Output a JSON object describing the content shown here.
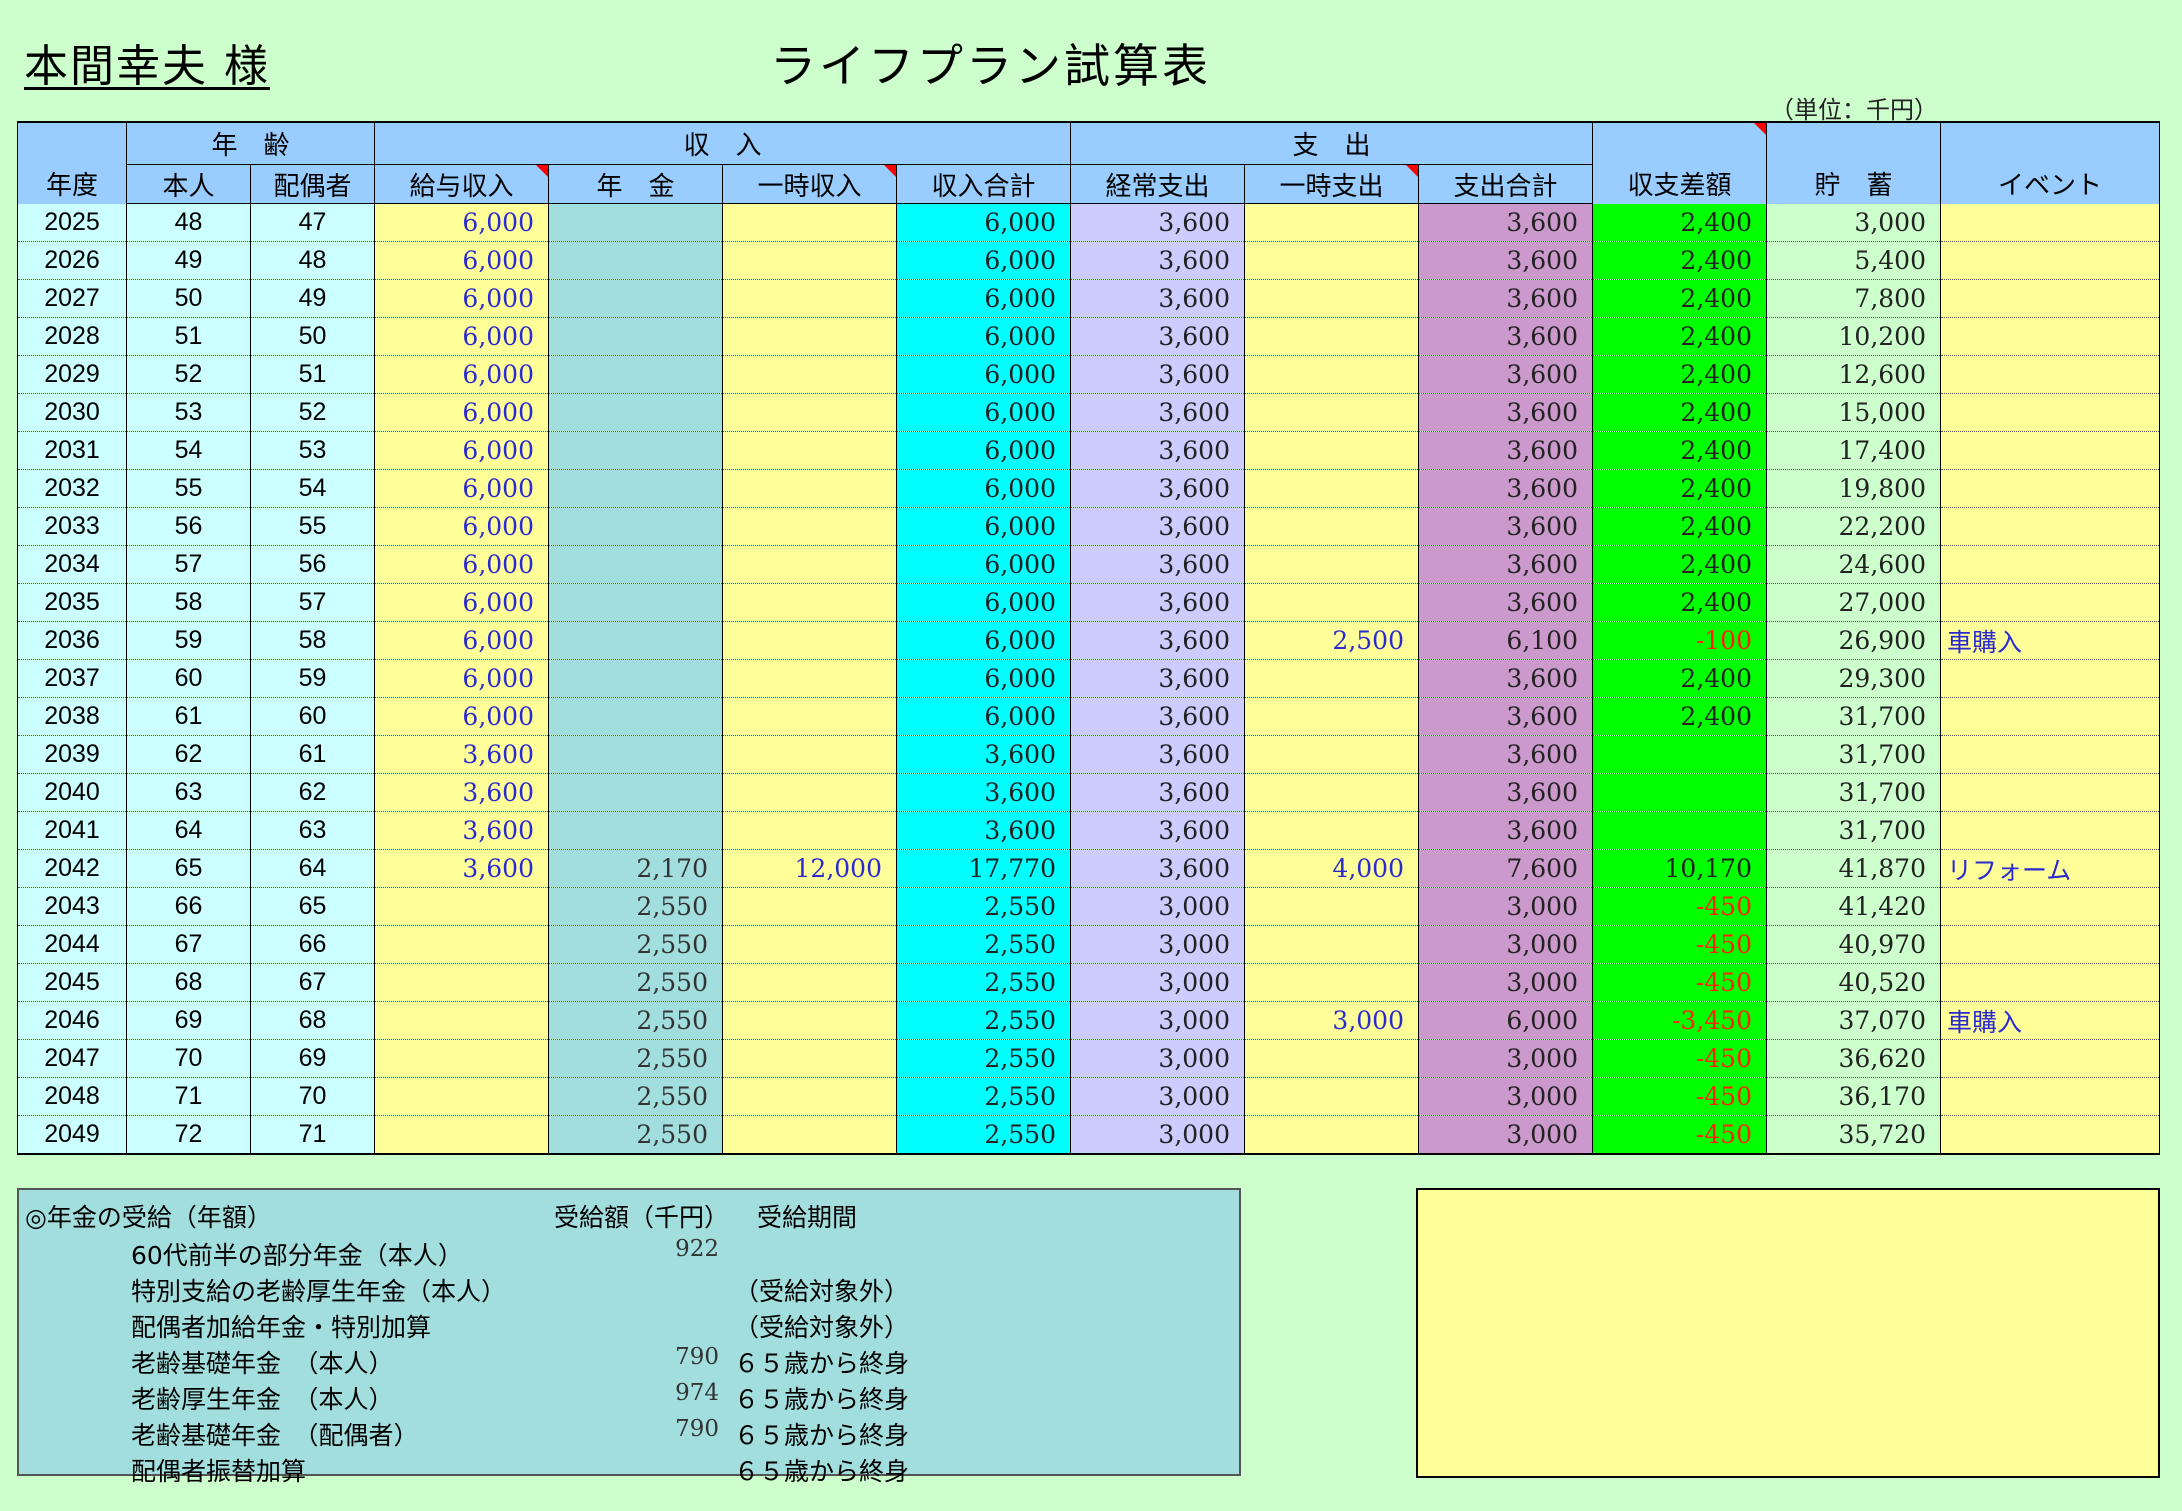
{
  "owner": "本間幸夫 様",
  "title": "ライフプラン試算表",
  "unit_note": "（単位：千円）",
  "headers": {
    "year": "年度",
    "age_group": "年　齢",
    "self": "本人",
    "spouse": "配偶者",
    "income_group": "収　入",
    "salary": "給与収入",
    "pension": "年　金",
    "temp_income": "一時収入",
    "income_total": "収入合計",
    "expense_group": "支　出",
    "regular_exp": "経常支出",
    "temp_exp": "一時支出",
    "exp_total": "支出合計",
    "balance": "収支差額",
    "savings": "貯　蓄",
    "event": "イベント"
  },
  "rows": [
    {
      "year": "2025",
      "self": "48",
      "spouse": "47",
      "salary": "6,000",
      "pension": "",
      "temp_in": "",
      "in_total": "6,000",
      "regular": "3,600",
      "temp_out": "",
      "out_total": "3,600",
      "balance": "2,400",
      "neg": false,
      "savings": "3,000",
      "event": ""
    },
    {
      "year": "2026",
      "self": "49",
      "spouse": "48",
      "salary": "6,000",
      "pension": "",
      "temp_in": "",
      "in_total": "6,000",
      "regular": "3,600",
      "temp_out": "",
      "out_total": "3,600",
      "balance": "2,400",
      "neg": false,
      "savings": "5,400",
      "event": ""
    },
    {
      "year": "2027",
      "self": "50",
      "spouse": "49",
      "salary": "6,000",
      "pension": "",
      "temp_in": "",
      "in_total": "6,000",
      "regular": "3,600",
      "temp_out": "",
      "out_total": "3,600",
      "balance": "2,400",
      "neg": false,
      "savings": "7,800",
      "event": ""
    },
    {
      "year": "2028",
      "self": "51",
      "spouse": "50",
      "salary": "6,000",
      "pension": "",
      "temp_in": "",
      "in_total": "6,000",
      "regular": "3,600",
      "temp_out": "",
      "out_total": "3,600",
      "balance": "2,400",
      "neg": false,
      "savings": "10,200",
      "event": ""
    },
    {
      "year": "2029",
      "self": "52",
      "spouse": "51",
      "salary": "6,000",
      "pension": "",
      "temp_in": "",
      "in_total": "6,000",
      "regular": "3,600",
      "temp_out": "",
      "out_total": "3,600",
      "balance": "2,400",
      "neg": false,
      "savings": "12,600",
      "event": ""
    },
    {
      "year": "2030",
      "self": "53",
      "spouse": "52",
      "salary": "6,000",
      "pension": "",
      "temp_in": "",
      "in_total": "6,000",
      "regular": "3,600",
      "temp_out": "",
      "out_total": "3,600",
      "balance": "2,400",
      "neg": false,
      "savings": "15,000",
      "event": ""
    },
    {
      "year": "2031",
      "self": "54",
      "spouse": "53",
      "salary": "6,000",
      "pension": "",
      "temp_in": "",
      "in_total": "6,000",
      "regular": "3,600",
      "temp_out": "",
      "out_total": "3,600",
      "balance": "2,400",
      "neg": false,
      "savings": "17,400",
      "event": ""
    },
    {
      "year": "2032",
      "self": "55",
      "spouse": "54",
      "salary": "6,000",
      "pension": "",
      "temp_in": "",
      "in_total": "6,000",
      "regular": "3,600",
      "temp_out": "",
      "out_total": "3,600",
      "balance": "2,400",
      "neg": false,
      "savings": "19,800",
      "event": ""
    },
    {
      "year": "2033",
      "self": "56",
      "spouse": "55",
      "salary": "6,000",
      "pension": "",
      "temp_in": "",
      "in_total": "6,000",
      "regular": "3,600",
      "temp_out": "",
      "out_total": "3,600",
      "balance": "2,400",
      "neg": false,
      "savings": "22,200",
      "event": ""
    },
    {
      "year": "2034",
      "self": "57",
      "spouse": "56",
      "salary": "6,000",
      "pension": "",
      "temp_in": "",
      "in_total": "6,000",
      "regular": "3,600",
      "temp_out": "",
      "out_total": "3,600",
      "balance": "2,400",
      "neg": false,
      "savings": "24,600",
      "event": ""
    },
    {
      "year": "2035",
      "self": "58",
      "spouse": "57",
      "salary": "6,000",
      "pension": "",
      "temp_in": "",
      "in_total": "6,000",
      "regular": "3,600",
      "temp_out": "",
      "out_total": "3,600",
      "balance": "2,400",
      "neg": false,
      "savings": "27,000",
      "event": ""
    },
    {
      "year": "2036",
      "self": "59",
      "spouse": "58",
      "salary": "6,000",
      "pension": "",
      "temp_in": "",
      "in_total": "6,000",
      "regular": "3,600",
      "temp_out": "2,500",
      "out_total": "6,100",
      "balance": "-100",
      "neg": true,
      "savings": "26,900",
      "event": "車購入"
    },
    {
      "year": "2037",
      "self": "60",
      "spouse": "59",
      "salary": "6,000",
      "pension": "",
      "temp_in": "",
      "in_total": "6,000",
      "regular": "3,600",
      "temp_out": "",
      "out_total": "3,600",
      "balance": "2,400",
      "neg": false,
      "savings": "29,300",
      "event": ""
    },
    {
      "year": "2038",
      "self": "61",
      "spouse": "60",
      "salary": "6,000",
      "pension": "",
      "temp_in": "",
      "in_total": "6,000",
      "regular": "3,600",
      "temp_out": "",
      "out_total": "3,600",
      "balance": "2,400",
      "neg": false,
      "savings": "31,700",
      "event": ""
    },
    {
      "year": "2039",
      "self": "62",
      "spouse": "61",
      "salary": "3,600",
      "pension": "",
      "temp_in": "",
      "in_total": "3,600",
      "regular": "3,600",
      "temp_out": "",
      "out_total": "3,600",
      "balance": "",
      "neg": false,
      "savings": "31,700",
      "event": ""
    },
    {
      "year": "2040",
      "self": "63",
      "spouse": "62",
      "salary": "3,600",
      "pension": "",
      "temp_in": "",
      "in_total": "3,600",
      "regular": "3,600",
      "temp_out": "",
      "out_total": "3,600",
      "balance": "",
      "neg": false,
      "savings": "31,700",
      "event": ""
    },
    {
      "year": "2041",
      "self": "64",
      "spouse": "63",
      "salary": "3,600",
      "pension": "",
      "temp_in": "",
      "in_total": "3,600",
      "regular": "3,600",
      "temp_out": "",
      "out_total": "3,600",
      "balance": "",
      "neg": false,
      "savings": "31,700",
      "event": ""
    },
    {
      "year": "2042",
      "self": "65",
      "spouse": "64",
      "salary": "3,600",
      "pension": "2,170",
      "temp_in": "12,000",
      "in_total": "17,770",
      "regular": "3,600",
      "temp_out": "4,000",
      "out_total": "7,600",
      "balance": "10,170",
      "neg": false,
      "savings": "41,870",
      "event": "リフォーム"
    },
    {
      "year": "2043",
      "self": "66",
      "spouse": "65",
      "salary": "",
      "pension": "2,550",
      "temp_in": "",
      "in_total": "2,550",
      "regular": "3,000",
      "temp_out": "",
      "out_total": "3,000",
      "balance": "-450",
      "neg": true,
      "savings": "41,420",
      "event": ""
    },
    {
      "year": "2044",
      "self": "67",
      "spouse": "66",
      "salary": "",
      "pension": "2,550",
      "temp_in": "",
      "in_total": "2,550",
      "regular": "3,000",
      "temp_out": "",
      "out_total": "3,000",
      "balance": "-450",
      "neg": true,
      "savings": "40,970",
      "event": ""
    },
    {
      "year": "2045",
      "self": "68",
      "spouse": "67",
      "salary": "",
      "pension": "2,550",
      "temp_in": "",
      "in_total": "2,550",
      "regular": "3,000",
      "temp_out": "",
      "out_total": "3,000",
      "balance": "-450",
      "neg": true,
      "savings": "40,520",
      "event": ""
    },
    {
      "year": "2046",
      "self": "69",
      "spouse": "68",
      "salary": "",
      "pension": "2,550",
      "temp_in": "",
      "in_total": "2,550",
      "regular": "3,000",
      "temp_out": "3,000",
      "out_total": "6,000",
      "balance": "-3,450",
      "neg": true,
      "savings": "37,070",
      "event": "車購入"
    },
    {
      "year": "2047",
      "self": "70",
      "spouse": "69",
      "salary": "",
      "pension": "2,550",
      "temp_in": "",
      "in_total": "2,550",
      "regular": "3,000",
      "temp_out": "",
      "out_total": "3,000",
      "balance": "-450",
      "neg": true,
      "savings": "36,620",
      "event": ""
    },
    {
      "year": "2048",
      "self": "71",
      "spouse": "70",
      "salary": "",
      "pension": "2,550",
      "temp_in": "",
      "in_total": "2,550",
      "regular": "3,000",
      "temp_out": "",
      "out_total": "3,000",
      "balance": "-450",
      "neg": true,
      "savings": "36,170",
      "event": ""
    },
    {
      "year": "2049",
      "self": "72",
      "spouse": "71",
      "salary": "",
      "pension": "2,550",
      "temp_in": "",
      "in_total": "2,550",
      "regular": "3,000",
      "temp_out": "",
      "out_total": "3,000",
      "balance": "-450",
      "neg": true,
      "savings": "35,720",
      "event": ""
    }
  ],
  "pension_box": {
    "heading": "◎年金の受給（年額）",
    "amount_header": "受給額（千円）",
    "period_header": "受給期間",
    "items": [
      {
        "label": "60代前半の部分年金（本人）",
        "amount": "922",
        "period": ""
      },
      {
        "label": "特別支給の老齢厚生年金（本人）",
        "amount": "",
        "period": "（受給対象外）"
      },
      {
        "label": "配偶者加給年金・特別加算",
        "amount": "",
        "period": "（受給対象外）"
      },
      {
        "label": "老齢基礎年金　（本人）",
        "amount": "790",
        "period": "６５歳から終身"
      },
      {
        "label": "老齢厚生年金　（本人）",
        "amount": "974",
        "period": "６５歳から終身"
      },
      {
        "label": "老齢基礎年金　（配偶者）",
        "amount": "790",
        "period": "６５歳から終身"
      },
      {
        "label": "配偶者振替加算",
        "amount": "",
        "period": "６５歳から終身"
      }
    ]
  },
  "colors": {
    "background": "#ccffcc",
    "header": "#99ccff",
    "age": "#ccffff",
    "salary": "#ffff99",
    "pension": "#a3dede",
    "income_total": "#00ffff",
    "regular_expense": "#ccccff",
    "expense_total": "#cc99cc",
    "balance": "#00ff00",
    "negative_text": "#ff2200",
    "input_text": "#2a2ad0"
  }
}
